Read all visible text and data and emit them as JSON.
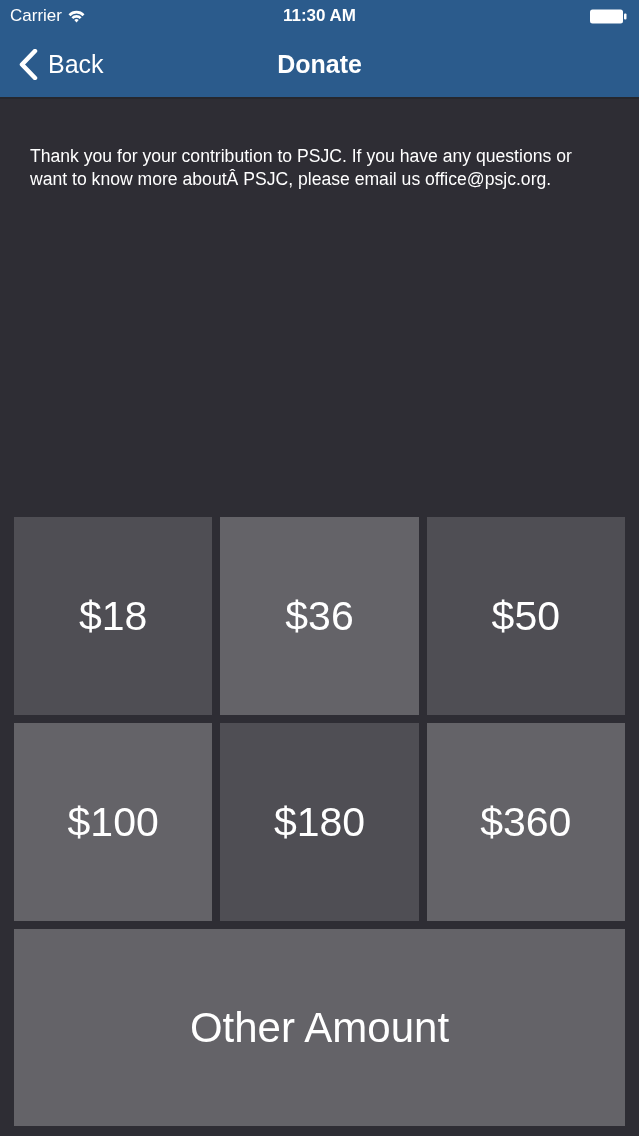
{
  "status_bar": {
    "carrier": "Carrier",
    "time": "11:30 AM"
  },
  "nav_bar": {
    "back": "Back",
    "title": "Donate"
  },
  "message": "Thank you for your contribution to PSJC. If you have any questions or want to know more aboutÂ PSJC, please email us office@psjc.org.",
  "amounts": [
    {
      "label": "$18",
      "color": "#4f4e54"
    },
    {
      "label": "$36",
      "color": "#646368"
    },
    {
      "label": "$50",
      "color": "#4f4e54"
    },
    {
      "label": "$100",
      "color": "#646368"
    },
    {
      "label": "$180",
      "color": "#4f4e54"
    },
    {
      "label": "$360",
      "color": "#646368"
    }
  ],
  "other_amount": {
    "label": "Other Amount",
    "color": "#646368"
  }
}
